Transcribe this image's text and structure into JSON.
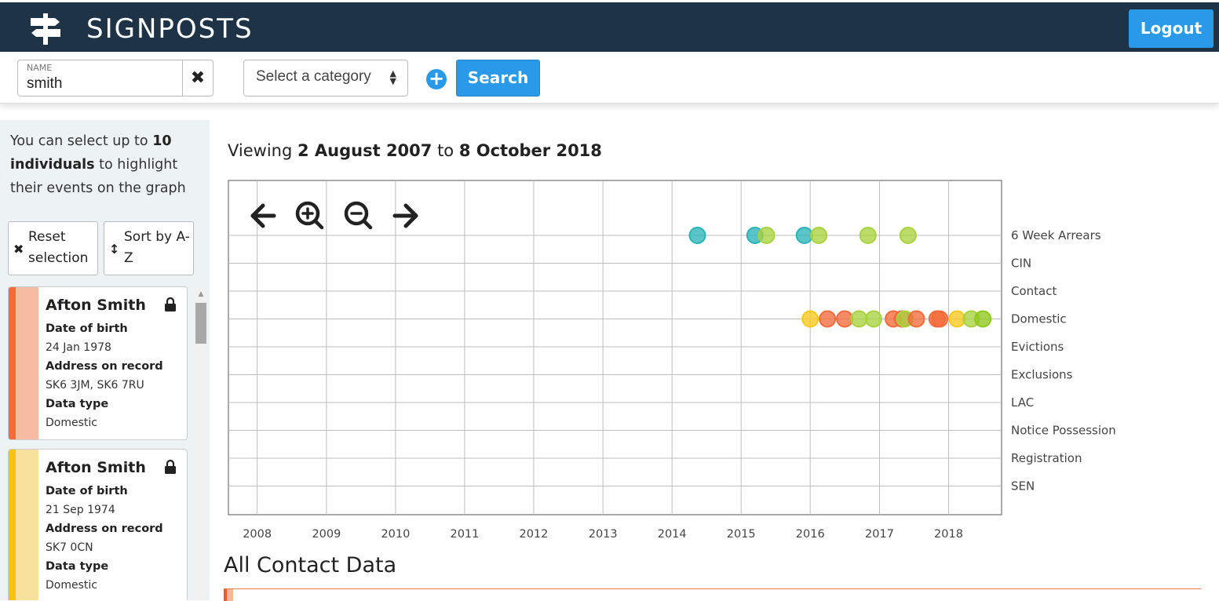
{
  "app": {
    "brand": "SIGNPOSTS",
    "logout_label": "Logout"
  },
  "search": {
    "name_label": "NAME",
    "name_value": "smith",
    "category_placeholder": "Select a category",
    "search_label": "Search"
  },
  "sidebar": {
    "intro_pre": "You can select up to ",
    "intro_bold": "10 individuals",
    "intro_post": " to highlight their events on the graph",
    "reset_label": "Reset selection",
    "sort_label": "Sort by A-Z",
    "cards": [
      {
        "name": "Afton Smith",
        "dob_label": "Date of birth",
        "dob": "24 Jan 1978",
        "address_label": "Address on record",
        "address": "SK6 3JM, SK6 7RU",
        "type_label": "Data type",
        "type": "Domestic",
        "color": "#f26b3a",
        "color_light": "#f5bca3"
      },
      {
        "name": "Afton Smith",
        "dob_label": "Date of birth",
        "dob": "21 Sep 1974",
        "address_label": "Address on record",
        "address": "SK7 0CN",
        "type_label": "Data type",
        "type": "Domestic",
        "color": "#f6c315",
        "color_light": "#f8e19c"
      }
    ]
  },
  "main": {
    "viewing_pre": "Viewing ",
    "viewing_from": "2 August 2007",
    "viewing_mid": " to ",
    "viewing_to": "8 October 2018",
    "section_title": "All Contact Data"
  },
  "chart_data": {
    "type": "scatter",
    "x_start": "2007-08-02",
    "x_end": "2018-10-08",
    "categories": [
      "6 Week Arrears",
      "CIN",
      "Contact",
      "Domestic",
      "Evictions",
      "Exclusions",
      "LAC",
      "Notice Possession",
      "Registration",
      "SEN"
    ],
    "x_ticks": [
      "2008",
      "2009",
      "2010",
      "2011",
      "2012",
      "2013",
      "2014",
      "2015",
      "2016",
      "2017",
      "2018"
    ],
    "grid": true,
    "controls": [
      "arrow-left-icon",
      "zoom-in-icon",
      "zoom-out-icon",
      "arrow-right-icon"
    ],
    "colors": {
      "teal": "#2bb3b8",
      "lime": "#a8d23f",
      "orange": "#f26b3a",
      "yellow": "#f8c81e",
      "green": "#8fc81b"
    },
    "points": [
      {
        "category": "6 Week Arrears",
        "date": "2014-05-15",
        "color": "teal"
      },
      {
        "category": "6 Week Arrears",
        "date": "2015-03-15",
        "color": "teal"
      },
      {
        "category": "6 Week Arrears",
        "date": "2015-05-15",
        "color": "lime"
      },
      {
        "category": "6 Week Arrears",
        "date": "2015-12-01",
        "color": "teal"
      },
      {
        "category": "6 Week Arrears",
        "date": "2016-02-15",
        "color": "lime"
      },
      {
        "category": "6 Week Arrears",
        "date": "2016-11-01",
        "color": "lime"
      },
      {
        "category": "6 Week Arrears",
        "date": "2017-06-01",
        "color": "lime"
      },
      {
        "category": "Domestic",
        "date": "2016-01-01",
        "color": "yellow"
      },
      {
        "category": "Domestic",
        "date": "2016-04-01",
        "color": "orange"
      },
      {
        "category": "Domestic",
        "date": "2016-07-01",
        "color": "orange"
      },
      {
        "category": "Domestic",
        "date": "2016-09-15",
        "color": "lime"
      },
      {
        "category": "Domestic",
        "date": "2016-12-01",
        "color": "lime"
      },
      {
        "category": "Domestic",
        "date": "2017-03-15",
        "color": "orange"
      },
      {
        "category": "Domestic",
        "date": "2017-05-01",
        "color": "orange"
      },
      {
        "category": "Domestic",
        "date": "2017-05-15",
        "color": "lime"
      },
      {
        "category": "Domestic",
        "date": "2017-07-15",
        "color": "orange"
      },
      {
        "category": "Domestic",
        "date": "2017-11-01",
        "color": "orange"
      },
      {
        "category": "Domestic",
        "date": "2017-11-15",
        "color": "orange"
      },
      {
        "category": "Domestic",
        "date": "2018-02-15",
        "color": "yellow"
      },
      {
        "category": "Domestic",
        "date": "2018-05-01",
        "color": "lime"
      },
      {
        "category": "Domestic",
        "date": "2018-07-01",
        "color": "green"
      }
    ]
  }
}
